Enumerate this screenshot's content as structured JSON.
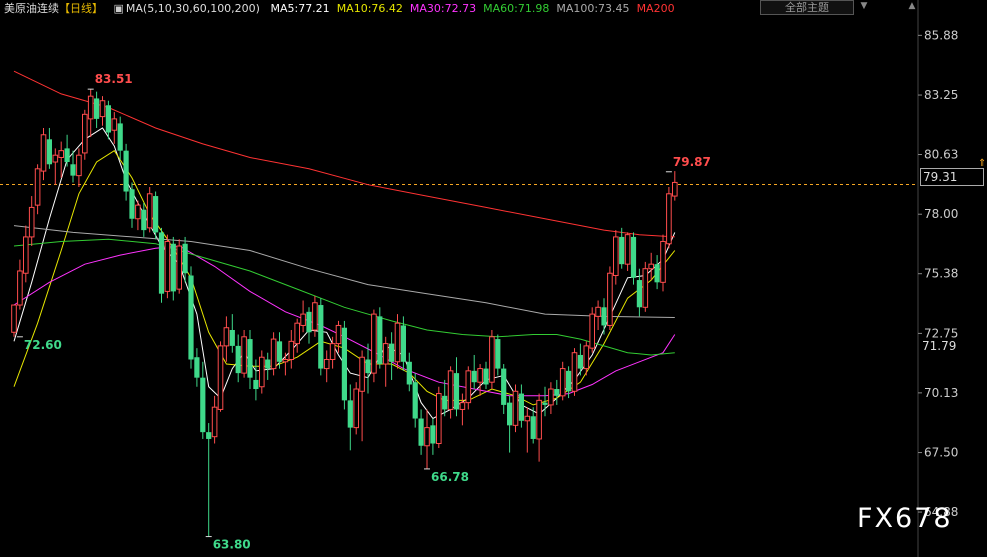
{
  "header": {
    "instrument": "美原油连续",
    "period": "【日线】",
    "ma_params": "MA(5,10,30,60,100,200)",
    "ma_values": [
      {
        "label": "MA5:77.21",
        "color": "#ffffff"
      },
      {
        "label": "MA10:76.42",
        "color": "#e6e600"
      },
      {
        "label": "MA30:72.73",
        "color": "#ff33ff"
      },
      {
        "label": "MA60:71.98",
        "color": "#33cc33"
      },
      {
        "label": "MA100:73.45",
        "color": "#aaaaaa"
      },
      {
        "label": "MA200",
        "color": "#ff3333"
      }
    ],
    "theme_button": "全部主题",
    "theme_arrow": "▼",
    "theme_arrow2": "▲"
  },
  "current_price": "79.31",
  "last_ma_label": "71.79",
  "watermark": "FX678",
  "chart_data": {
    "type": "candlestick",
    "ylim": [
      62.9,
      86.6
    ],
    "yticks": [
      85.88,
      83.25,
      80.63,
      78.0,
      75.38,
      72.75,
      70.13,
      67.5,
      64.88
    ],
    "ytick_labels": [
      "85.88",
      "83.25",
      "80.63",
      "78.00",
      "75.38",
      "72.75",
      "70.13",
      "67.50",
      "64.88"
    ],
    "current_price": 79.31,
    "annotations": [
      {
        "label": "83.51",
        "index": 13,
        "price": 83.51,
        "kind": "high"
      },
      {
        "label": "72.60",
        "index": 1,
        "price": 72.6,
        "kind": "low"
      },
      {
        "label": "63.80",
        "index": 33,
        "price": 63.8,
        "kind": "low"
      },
      {
        "label": "66.78",
        "index": 70,
        "price": 66.78,
        "kind": "low"
      },
      {
        "label": "79.87",
        "index": 111,
        "price": 79.87,
        "kind": "high"
      }
    ],
    "candles": [
      [
        72.8,
        74.0,
        72.6,
        74.0
      ],
      [
        74.0,
        76.0,
        73.8,
        75.5
      ],
      [
        75.4,
        77.5,
        75.0,
        77.0
      ],
      [
        77.0,
        78.8,
        76.6,
        78.3
      ],
      [
        78.4,
        80.2,
        78.0,
        80.0
      ],
      [
        79.9,
        81.8,
        79.5,
        81.5
      ],
      [
        81.3,
        81.8,
        80.0,
        80.2
      ],
      [
        80.3,
        80.9,
        79.3,
        80.6
      ],
      [
        80.5,
        81.2,
        79.6,
        80.8
      ],
      [
        80.9,
        81.5,
        80.1,
        80.3
      ],
      [
        80.2,
        80.8,
        79.4,
        79.7
      ],
      [
        79.7,
        80.9,
        79.2,
        80.6
      ],
      [
        80.7,
        82.6,
        80.4,
        82.4
      ],
      [
        82.2,
        83.5,
        81.4,
        83.2
      ],
      [
        83.1,
        83.4,
        81.8,
        82.2
      ],
      [
        82.3,
        83.2,
        81.9,
        83.0
      ],
      [
        82.8,
        83.0,
        81.3,
        81.6
      ],
      [
        81.7,
        82.5,
        81.1,
        82.2
      ],
      [
        82.0,
        82.3,
        80.4,
        80.8
      ],
      [
        80.8,
        81.1,
        78.6,
        79.0
      ],
      [
        79.1,
        79.4,
        77.4,
        77.8
      ],
      [
        77.8,
        78.6,
        77.3,
        78.4
      ],
      [
        78.2,
        78.5,
        77.0,
        77.3
      ],
      [
        77.4,
        79.2,
        77.2,
        78.9
      ],
      [
        78.8,
        79.0,
        76.9,
        77.2
      ],
      [
        77.2,
        77.4,
        74.1,
        74.5
      ],
      [
        74.6,
        77.1,
        74.3,
        76.8
      ],
      [
        76.7,
        77.0,
        74.2,
        74.6
      ],
      [
        74.7,
        76.9,
        74.5,
        76.6
      ],
      [
        76.7,
        77.0,
        75.0,
        75.4
      ],
      [
        75.3,
        75.7,
        71.2,
        71.6
      ],
      [
        71.7,
        72.1,
        70.4,
        70.8
      ],
      [
        70.8,
        71.5,
        68.1,
        68.4
      ],
      [
        68.4,
        68.8,
        63.8,
        68.1
      ],
      [
        68.2,
        70.0,
        67.9,
        69.5
      ],
      [
        69.4,
        72.4,
        69.3,
        72.2
      ],
      [
        72.2,
        73.5,
        71.5,
        73.0
      ],
      [
        72.9,
        73.6,
        71.9,
        72.2
      ],
      [
        72.2,
        72.7,
        70.6,
        71.0
      ],
      [
        71.0,
        72.9,
        70.8,
        72.6
      ],
      [
        72.5,
        72.9,
        70.3,
        70.8
      ],
      [
        70.7,
        71.6,
        69.8,
        70.3
      ],
      [
        70.4,
        72.0,
        70.1,
        71.7
      ],
      [
        71.6,
        71.9,
        70.7,
        71.2
      ],
      [
        71.2,
        72.8,
        70.9,
        72.5
      ],
      [
        72.4,
        72.8,
        71.2,
        71.5
      ],
      [
        71.5,
        71.9,
        70.9,
        71.6
      ],
      [
        71.6,
        72.9,
        71.2,
        72.4
      ],
      [
        72.3,
        73.4,
        71.9,
        73.2
      ],
      [
        73.1,
        74.2,
        72.8,
        73.6
      ],
      [
        73.7,
        73.9,
        72.3,
        72.8
      ],
      [
        72.9,
        74.4,
        72.6,
        74.1
      ],
      [
        74.0,
        74.3,
        70.9,
        71.2
      ],
      [
        71.2,
        72.0,
        70.6,
        71.6
      ],
      [
        71.6,
        72.6,
        71.2,
        72.3
      ],
      [
        72.3,
        73.3,
        71.9,
        73.1
      ],
      [
        73.0,
        73.3,
        69.4,
        69.8
      ],
      [
        69.8,
        70.5,
        67.6,
        68.6
      ],
      [
        68.6,
        70.6,
        68.3,
        70.3
      ],
      [
        70.2,
        72.0,
        68.0,
        71.7
      ],
      [
        71.6,
        72.3,
        70.1,
        71.0
      ],
      [
        71.0,
        73.8,
        70.6,
        73.6
      ],
      [
        73.5,
        73.9,
        71.2,
        71.4
      ],
      [
        71.4,
        72.6,
        70.4,
        72.3
      ],
      [
        72.3,
        72.8,
        70.7,
        71.5
      ],
      [
        71.5,
        73.6,
        71.2,
        73.2
      ],
      [
        73.1,
        73.5,
        71.1,
        71.5
      ],
      [
        71.5,
        71.9,
        70.2,
        70.5
      ],
      [
        70.6,
        71.0,
        68.6,
        69.0
      ],
      [
        69.0,
        69.4,
        67.4,
        67.8
      ],
      [
        67.8,
        69.4,
        66.8,
        68.6
      ],
      [
        68.7,
        69.0,
        67.4,
        67.9
      ],
      [
        67.9,
        70.4,
        67.7,
        70.1
      ],
      [
        70.0,
        70.7,
        69.1,
        69.4
      ],
      [
        69.4,
        71.3,
        69.0,
        71.1
      ],
      [
        71.0,
        71.7,
        69.1,
        69.4
      ],
      [
        69.4,
        70.1,
        68.7,
        69.7
      ],
      [
        69.7,
        71.3,
        69.4,
        71.1
      ],
      [
        71.1,
        71.8,
        70.3,
        70.6
      ],
      [
        70.6,
        71.4,
        70.0,
        71.2
      ],
      [
        71.2,
        71.5,
        70.3,
        70.5
      ],
      [
        70.6,
        72.9,
        70.3,
        72.6
      ],
      [
        72.5,
        72.7,
        70.9,
        71.2
      ],
      [
        71.2,
        71.4,
        69.2,
        69.6
      ],
      [
        69.7,
        70.0,
        67.5,
        68.7
      ],
      [
        68.7,
        70.5,
        68.4,
        70.2
      ],
      [
        70.1,
        70.5,
        68.6,
        68.9
      ],
      [
        68.9,
        69.5,
        67.5,
        69.1
      ],
      [
        69.1,
        69.5,
        67.9,
        68.1
      ],
      [
        68.1,
        70.1,
        67.1,
        69.8
      ],
      [
        69.7,
        70.4,
        69.1,
        69.6
      ],
      [
        69.6,
        70.6,
        69.2,
        70.3
      ],
      [
        70.3,
        70.7,
        69.6,
        70.0
      ],
      [
        70.0,
        71.5,
        69.8,
        71.2
      ],
      [
        71.1,
        71.3,
        69.9,
        70.2
      ],
      [
        70.2,
        72.1,
        70.0,
        71.9
      ],
      [
        71.8,
        72.3,
        70.9,
        71.2
      ],
      [
        71.2,
        72.4,
        70.9,
        72.2
      ],
      [
        72.1,
        73.9,
        71.9,
        73.6
      ],
      [
        73.5,
        74.2,
        72.9,
        73.9
      ],
      [
        73.9,
        74.3,
        72.7,
        73.1
      ],
      [
        73.1,
        75.7,
        72.9,
        75.4
      ],
      [
        75.3,
        77.3,
        74.9,
        77.0
      ],
      [
        77.0,
        77.4,
        75.6,
        75.8
      ],
      [
        75.8,
        77.2,
        75.5,
        77.1
      ],
      [
        77.0,
        77.2,
        74.9,
        75.2
      ],
      [
        75.1,
        75.6,
        73.5,
        73.9
      ],
      [
        73.9,
        75.9,
        73.7,
        75.6
      ],
      [
        75.6,
        76.3,
        75.1,
        75.8
      ],
      [
        75.8,
        76.2,
        74.7,
        75.0
      ],
      [
        75.0,
        77.1,
        74.6,
        76.8
      ],
      [
        76.7,
        79.2,
        76.5,
        78.9
      ],
      [
        78.8,
        79.9,
        78.6,
        79.4
      ]
    ],
    "ma_series": [
      {
        "name": "MA5",
        "color": "#ffffff",
        "points": [
          [
            0,
            72.4
          ],
          [
            3,
            75.0
          ],
          [
            6,
            77.8
          ],
          [
            9,
            80.4
          ],
          [
            12,
            81.3
          ],
          [
            15,
            81.8
          ],
          [
            17,
            81.0
          ],
          [
            19,
            79.5
          ],
          [
            22,
            78.0
          ],
          [
            25,
            76.6
          ],
          [
            28,
            75.8
          ],
          [
            31,
            73.6
          ],
          [
            33,
            70.4
          ],
          [
            35,
            69.9
          ],
          [
            37,
            71.2
          ],
          [
            39,
            71.9
          ],
          [
            41,
            71.1
          ],
          [
            44,
            71.2
          ],
          [
            47,
            72.0
          ],
          [
            50,
            72.9
          ],
          [
            53,
            72.8
          ],
          [
            55,
            71.8
          ],
          [
            57,
            71.0
          ],
          [
            60,
            70.8
          ],
          [
            63,
            72.2
          ],
          [
            66,
            71.8
          ],
          [
            69,
            69.7
          ],
          [
            71,
            69.0
          ],
          [
            74,
            69.4
          ],
          [
            77,
            69.9
          ],
          [
            80,
            70.7
          ],
          [
            83,
            70.9
          ],
          [
            86,
            69.6
          ],
          [
            89,
            69.2
          ],
          [
            92,
            69.9
          ],
          [
            95,
            70.7
          ],
          [
            98,
            71.8
          ],
          [
            101,
            73.5
          ],
          [
            104,
            75.2
          ],
          [
            107,
            75.3
          ],
          [
            110,
            76.0
          ],
          [
            112,
            77.2
          ]
        ]
      },
      {
        "name": "MA10",
        "color": "#e6e600",
        "points": [
          [
            0,
            70.4
          ],
          [
            4,
            73.2
          ],
          [
            8,
            76.4
          ],
          [
            11,
            78.9
          ],
          [
            14,
            80.3
          ],
          [
            17,
            80.8
          ],
          [
            20,
            79.6
          ],
          [
            23,
            78.0
          ],
          [
            26,
            76.9
          ],
          [
            30,
            75.2
          ],
          [
            33,
            72.8
          ],
          [
            36,
            71.4
          ],
          [
            40,
            71.3
          ],
          [
            44,
            71.3
          ],
          [
            48,
            71.7
          ],
          [
            52,
            72.4
          ],
          [
            56,
            72.1
          ],
          [
            60,
            71.4
          ],
          [
            64,
            71.4
          ],
          [
            67,
            71.0
          ],
          [
            70,
            70.2
          ],
          [
            73,
            69.8
          ],
          [
            77,
            69.8
          ],
          [
            81,
            70.3
          ],
          [
            85,
            70.0
          ],
          [
            88,
            69.6
          ],
          [
            92,
            69.9
          ],
          [
            96,
            70.6
          ],
          [
            100,
            72.3
          ],
          [
            104,
            74.3
          ],
          [
            108,
            75.1
          ],
          [
            112,
            76.4
          ]
        ]
      },
      {
        "name": "MA30",
        "color": "#ff33ff",
        "points": [
          [
            0,
            74.0
          ],
          [
            6,
            75.0
          ],
          [
            12,
            75.8
          ],
          [
            18,
            76.2
          ],
          [
            24,
            76.5
          ],
          [
            28,
            76.6
          ],
          [
            34,
            75.7
          ],
          [
            40,
            74.6
          ],
          [
            46,
            73.7
          ],
          [
            52,
            73.1
          ],
          [
            56,
            72.6
          ],
          [
            62,
            71.8
          ],
          [
            66,
            71.2
          ],
          [
            72,
            70.6
          ],
          [
            78,
            70.3
          ],
          [
            84,
            70.0
          ],
          [
            90,
            70.0
          ],
          [
            94,
            70.1
          ],
          [
            98,
            70.5
          ],
          [
            102,
            71.1
          ],
          [
            106,
            71.5
          ],
          [
            110,
            71.9
          ],
          [
            112,
            72.7
          ]
        ]
      },
      {
        "name": "MA60",
        "color": "#33cc33",
        "points": [
          [
            0,
            76.6
          ],
          [
            8,
            76.8
          ],
          [
            16,
            76.9
          ],
          [
            24,
            76.7
          ],
          [
            32,
            76.1
          ],
          [
            40,
            75.5
          ],
          [
            48,
            74.7
          ],
          [
            56,
            73.9
          ],
          [
            64,
            73.3
          ],
          [
            70,
            72.9
          ],
          [
            76,
            72.7
          ],
          [
            82,
            72.6
          ],
          [
            88,
            72.7
          ],
          [
            92,
            72.7
          ],
          [
            96,
            72.5
          ],
          [
            100,
            72.2
          ],
          [
            104,
            71.9
          ],
          [
            108,
            71.8
          ],
          [
            112,
            71.9
          ]
        ]
      },
      {
        "name": "MA100",
        "color": "#aaaaaa",
        "points": [
          [
            0,
            77.5
          ],
          [
            10,
            77.2
          ],
          [
            20,
            77.0
          ],
          [
            30,
            76.8
          ],
          [
            40,
            76.4
          ],
          [
            50,
            75.6
          ],
          [
            60,
            74.9
          ],
          [
            70,
            74.5
          ],
          [
            80,
            74.1
          ],
          [
            90,
            73.6
          ],
          [
            100,
            73.5
          ],
          [
            112,
            73.45
          ]
        ]
      },
      {
        "name": "MA200",
        "color": "#ff3333",
        "points": [
          [
            0,
            84.3
          ],
          [
            8,
            83.3
          ],
          [
            16,
            82.7
          ],
          [
            24,
            81.8
          ],
          [
            32,
            81.1
          ],
          [
            40,
            80.5
          ],
          [
            50,
            80.0
          ],
          [
            60,
            79.3
          ],
          [
            70,
            78.8
          ],
          [
            80,
            78.3
          ],
          [
            90,
            77.8
          ],
          [
            100,
            77.3
          ],
          [
            106,
            77.1
          ],
          [
            112,
            77.0
          ]
        ]
      }
    ]
  }
}
